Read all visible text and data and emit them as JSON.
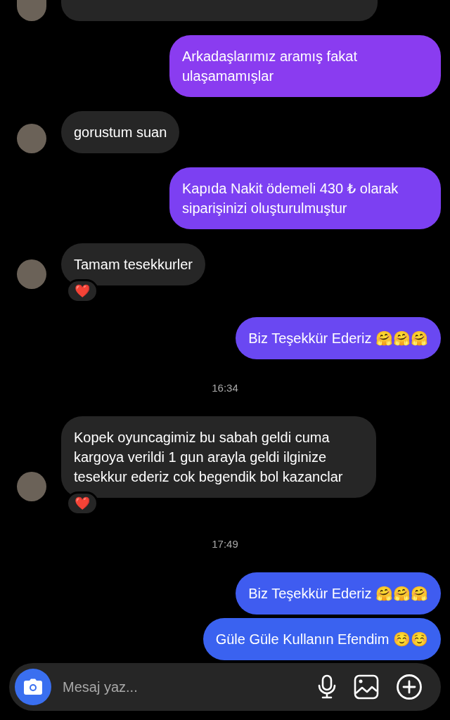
{
  "messages": [
    {
      "kind": "received_cut"
    },
    {
      "kind": "sent",
      "text": "Arkadaşlarımız aramış fakat ulaşamamışlar",
      "color": "#8a3cf0"
    },
    {
      "kind": "received",
      "text": "gorustum suan"
    },
    {
      "kind": "sent",
      "text": "Kapıda Nakit ödemeli 430 ₺ olarak siparişinizi oluşturulmuştur",
      "color": "#7c40f2"
    },
    {
      "kind": "received",
      "text": "Tamam tesekkurler",
      "reaction": "❤️"
    },
    {
      "kind": "sent",
      "text": "Biz Teşekkür Ederiz 🤗🤗🤗",
      "color": "#6a48f2"
    },
    {
      "kind": "time",
      "text": "16:34"
    },
    {
      "kind": "received",
      "text": "Kopek oyuncagimiz bu sabah geldi cuma kargoya verildi 1 gun arayla geldi ilginize tesekkur ederiz cok begendik bol kazanclar",
      "reaction": "❤️"
    },
    {
      "kind": "time",
      "text": "17:49"
    },
    {
      "kind": "sent",
      "text": "Biz Teşekkür Ederiz 🤗🤗🤗",
      "color": "#3f5cf0"
    },
    {
      "kind": "sent",
      "text": "Güle Güle Kullanın Efendim ☺️☺️",
      "color": "#3a62f0"
    }
  ],
  "composer": {
    "placeholder": "Mesaj yaz..."
  }
}
